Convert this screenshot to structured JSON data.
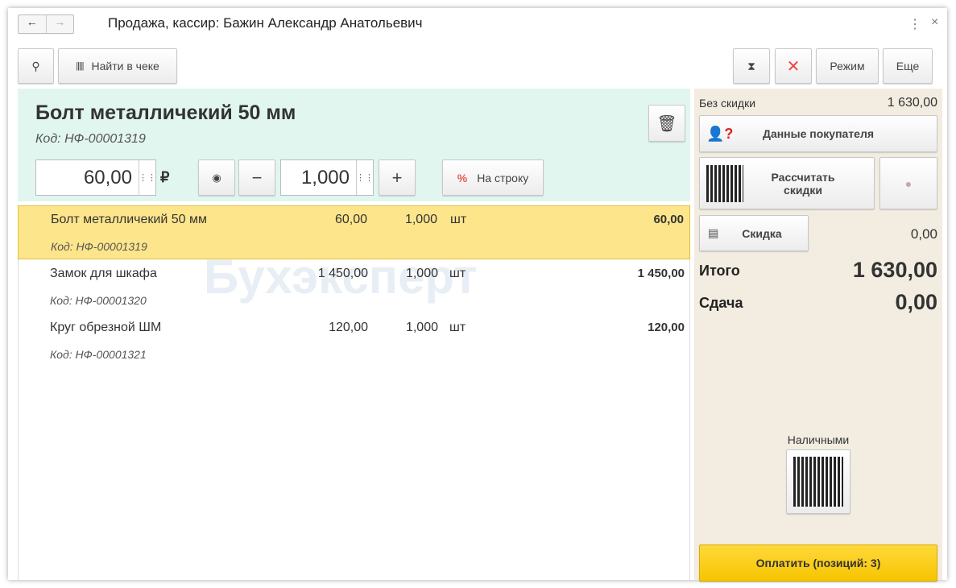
{
  "window": {
    "title": "Продажа, кассир: Бажин Александр Анатольевич"
  },
  "toolbar": {
    "find_label": "Найти в чеке",
    "mode_label": "Режим",
    "more_label": "Еще"
  },
  "current": {
    "name": "Болт металличекий 50 мм",
    "code": "Код: НФ-00001319",
    "price": "60,00",
    "currency": "₽",
    "quantity": "1,000",
    "to_line_label": "На строку"
  },
  "items": [
    {
      "name": "Болт металличекий 50 мм",
      "price": "60,00",
      "qty": "1,000",
      "unit": "шт",
      "sum": "60,00",
      "code": "Код: НФ-00001319"
    },
    {
      "name": "Замок для шкафа",
      "price": "1 450,00",
      "qty": "1,000",
      "unit": "шт",
      "sum": "1 450,00",
      "code": "Код: НФ-00001320"
    },
    {
      "name": "Круг обрезной ШМ",
      "price": "120,00",
      "qty": "1,000",
      "unit": "шт",
      "sum": "120,00",
      "code": "Код: НФ-00001321"
    }
  ],
  "summary": {
    "no_discount_label": "Без скидки",
    "no_discount_value": "1 630,00",
    "customer_label": "Данные покупателя",
    "calc_discount_label": "Рассчитать скидки",
    "discount_label": "Скидка",
    "discount_value": "0,00",
    "total_label": "Итого",
    "total_value": "1 630,00",
    "change_label": "Сдача",
    "change_value": "0,00",
    "cash_label": "Наличными",
    "pay_label": "Оплатить (позиций: 3)"
  },
  "watermark": "Бухэксперт"
}
